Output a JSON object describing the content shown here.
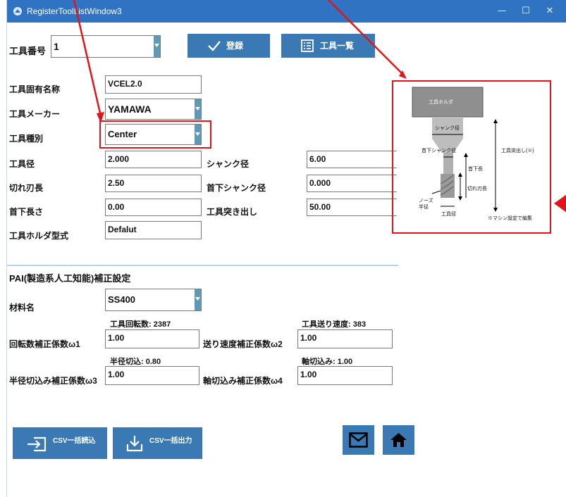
{
  "window": {
    "title": "RegisterToolListWindow3",
    "controls": {
      "minimize": "—",
      "maximize": "☐",
      "close": "✕"
    }
  },
  "header": {
    "tool_number_label": "工具番号",
    "tool_number_value": "1",
    "register_button": "登録",
    "tool_list_button": "工具一覧"
  },
  "form": {
    "unique_name_label": "工具固有名称",
    "unique_name_value": "VCEL2.0",
    "maker_label": "工具メーカー",
    "maker_value": "YAMAWA",
    "type_label": "工具種別",
    "type_value": "Center",
    "diameter_label": "工具径",
    "diameter_value": "2.000",
    "edge_length_label": "切れ刃長",
    "edge_length_value": "2.50",
    "neck_length_label": "首下長さ",
    "neck_length_value": "0.00",
    "holder_label": "工具ホルダ型式",
    "holder_value": "Defalut",
    "shank_dia_label": "シャンク径",
    "shank_dia_value": "6.00",
    "neck_shank_label": "首下シャンク径",
    "neck_shank_value": "0.000",
    "protrusion_label": "工具突き出し",
    "protrusion_value": "50.00"
  },
  "diagram": {
    "holder": "工具ホルダ",
    "shank": "シャンク径",
    "neck_shank": "首下シャンク径",
    "protrusion": "工具突出し(※)",
    "neck_length": "首下長",
    "edge_length": "切れ刃長",
    "nose_line1": "ノーズ",
    "nose_line2": "半径",
    "tool_dia": "工具径",
    "note": "※マシン設定で編集"
  },
  "pai": {
    "section_title": "PAI(製造系人工知能)補正設定",
    "material_label": "材料名",
    "material_value": "SS400",
    "rpm_info": "工具回転数: 2387",
    "feed_info": "工具送り速度: 383",
    "rpm_coef_label": "回転数補正係数ω1",
    "rpm_coef_value": "1.00",
    "feed_coef_label": "送り速度補正係数ω2",
    "feed_coef_value": "1.00",
    "radial_info": "半径切込: 0.80",
    "axial_info": "軸切込み: 1.00",
    "radial_coef_label": "半径切込み補正係数ω3",
    "radial_coef_value": "1.00",
    "axial_coef_label": "軸切込み補正係数ω4",
    "axial_coef_value": "1.00"
  },
  "footer": {
    "csv_import": "CSV一括読込",
    "csv_export": "CSV一括出力"
  },
  "colors": {
    "titlebar": "#2f73c2",
    "button": "#3a79b3",
    "annotation": "#e0151a",
    "dropdown": "#5d9ab8"
  }
}
